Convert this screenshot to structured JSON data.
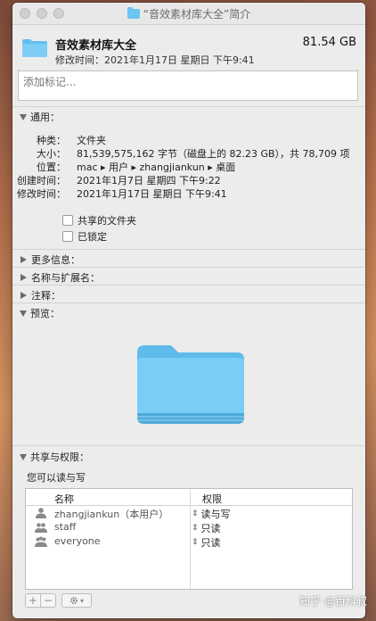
{
  "window": {
    "title": "“音效素材库大全”简介"
  },
  "header": {
    "name": "音效素材库大全",
    "size": "81.54 GB",
    "modified": "修改时间：2021年1月17日 星期日 下午9:41"
  },
  "tags": {
    "placeholder": "添加标记..."
  },
  "general": {
    "section_label": "通用：",
    "rows": [
      {
        "key": "种类：",
        "value": "文件夹"
      },
      {
        "key": "大小：",
        "value": "81,539,575,162 字节（磁盘上的 82.23 GB），共 78,709 项"
      },
      {
        "key": "位置：",
        "value": "mac ▸ 用户 ▸ zhangjiankun ▸ 桌面"
      },
      {
        "key": "创建时间：",
        "value": "2021年1月7日 星期四 下午9:22"
      },
      {
        "key": "修改时间：",
        "value": "2021年1月17日 星期日 下午9:41"
      }
    ],
    "shared_folder": "共享的文件夹",
    "locked": "已锁定"
  },
  "sections": {
    "more_info": "更多信息：",
    "name_ext": "名称与扩展名：",
    "comments": "注释：",
    "preview": "预览：",
    "sharing": "共享与权限："
  },
  "permissions": {
    "caption": "您可以读与写",
    "col_name": "名称",
    "col_perm": "权限",
    "rows": [
      {
        "name": "zhangjiankun（本用户）",
        "perm": "读与写"
      },
      {
        "name": "staff",
        "perm": "只读"
      },
      {
        "name": "everyone",
        "perm": "只读"
      }
    ]
  },
  "bottom": {
    "add": "+",
    "remove": "−"
  },
  "watermark": "知乎 @百科叔"
}
